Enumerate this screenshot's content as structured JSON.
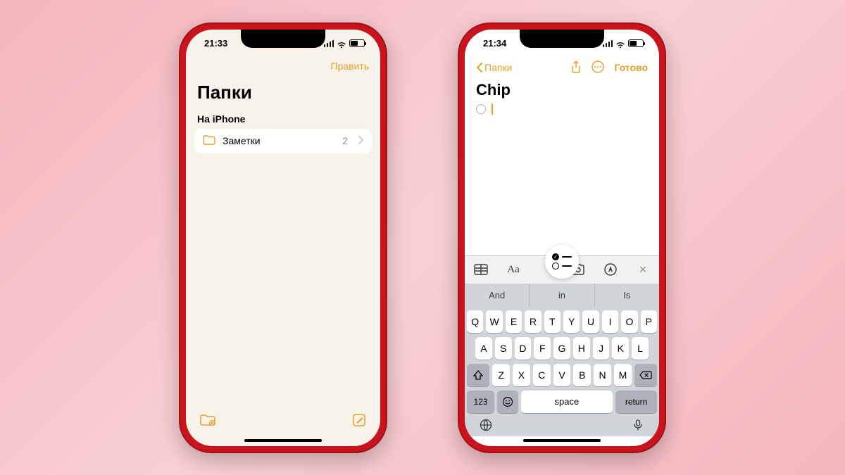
{
  "colors": {
    "accent": "#e1a32a",
    "phone_body": "#c9141e"
  },
  "phone1": {
    "status": {
      "time": "21:33"
    },
    "nav": {
      "edit": "Править"
    },
    "title": "Папки",
    "section": "На iPhone",
    "folder": {
      "name": "Заметки",
      "count": "2"
    }
  },
  "phone2": {
    "status": {
      "time": "21:34"
    },
    "nav": {
      "back": "Папки",
      "done": "Готово"
    },
    "note": {
      "title": "Chip"
    },
    "toolbar": {
      "aa": "Aa"
    },
    "predictive": [
      "And",
      "in",
      "Is"
    ],
    "keyboard": {
      "row1": [
        "Q",
        "W",
        "E",
        "R",
        "T",
        "Y",
        "U",
        "I",
        "O",
        "P"
      ],
      "row2": [
        "A",
        "S",
        "D",
        "F",
        "G",
        "H",
        "J",
        "K",
        "L"
      ],
      "row3": [
        "Z",
        "X",
        "C",
        "V",
        "B",
        "N",
        "M"
      ],
      "num": "123",
      "space": "space",
      "return": "return"
    }
  }
}
